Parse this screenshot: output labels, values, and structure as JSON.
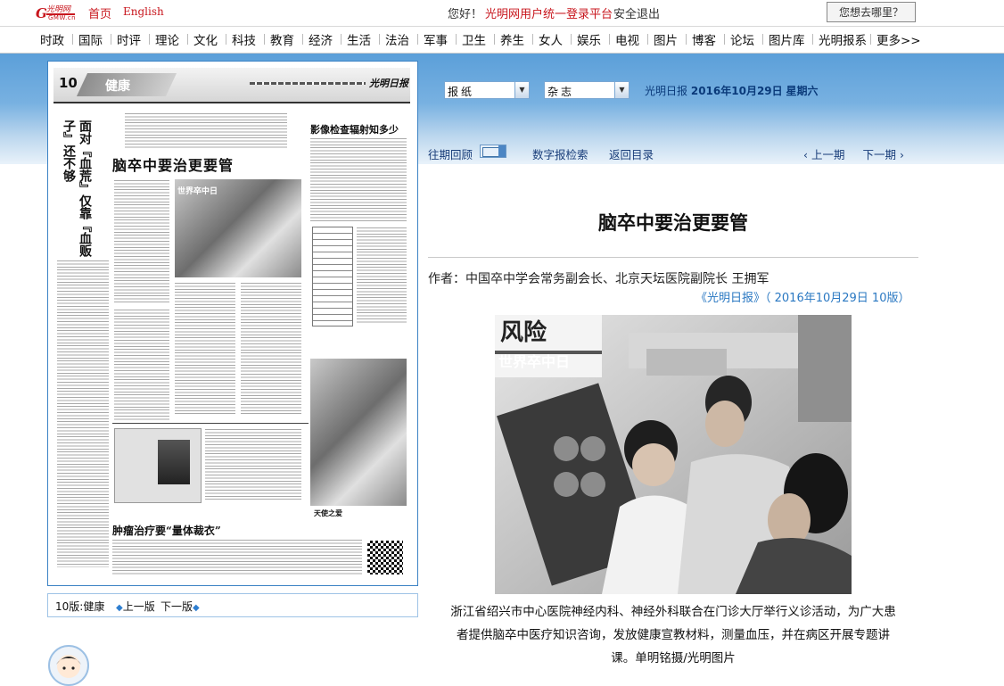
{
  "topbar": {
    "logo_lines": [
      "光明网",
      "GMW.cn"
    ],
    "home": "首页",
    "english": "English",
    "greeting": "您好！",
    "login": "光明网用户统一登录平台",
    "logout": "安全退出",
    "where": "您想去哪里？"
  },
  "channels": [
    "时政",
    "国际",
    "时评",
    "理论",
    "文化",
    "科技",
    "教育",
    "经济",
    "生活",
    "法治",
    "军事",
    "卫生",
    "养生",
    "女人",
    "娱乐",
    "电视",
    "图片",
    "博客",
    "论坛",
    "图片库",
    "光明报系",
    "更多>>"
  ],
  "controls": {
    "select_paper": "报纸",
    "select_magazine": "杂志",
    "issue_name": "光明日报",
    "issue_date": "2016年10月29日",
    "issue_weekday": "星期六",
    "past_review": "往期回顾",
    "digital_search": "数字报检索",
    "back_to_index": "返回目录",
    "prev_issue": "上一期",
    "next_issue": "下一期"
  },
  "page_footer": {
    "label": "10版:健康",
    "prev": "上一版",
    "next": "下一版"
  },
  "newspaper": {
    "page_num": "10",
    "section": "健康",
    "masthead": "光明日报",
    "headline_main": "脑卒中要治更要管",
    "headline_side": "面对『血荒』仅靠『血贩子』还不够",
    "headline_right": "影像检查辐射知多少",
    "headline_bottom": "肿瘤治疗要“量体裁衣”",
    "poster_text": "世界卒中日",
    "sky_text": "天使之爱"
  },
  "article": {
    "title": "脑卒中要治更要管",
    "author": "作者：中国卒中学会常务副会长、北京天坛医院副院长 王拥军",
    "source": "《光明日报》（ 2016年10月29日 10版）",
    "photo_banner_1": "风险",
    "photo_banner_2": "世界卒中日",
    "caption": "浙江省绍兴市中心医院神经内科、神经外科联合在门诊大厅举行义诊活动，为广大患者提供脑卒中医疗知识咨询，发放健康宣教材料，测量血压，并在病区开展专题讲课。单明铭摄/光明图片"
  },
  "colors": {
    "accent_red": "#c8161d",
    "link_blue": "#1a3e7a",
    "band_blue": "#5b9fd9",
    "source_blue": "#2a78c2"
  }
}
